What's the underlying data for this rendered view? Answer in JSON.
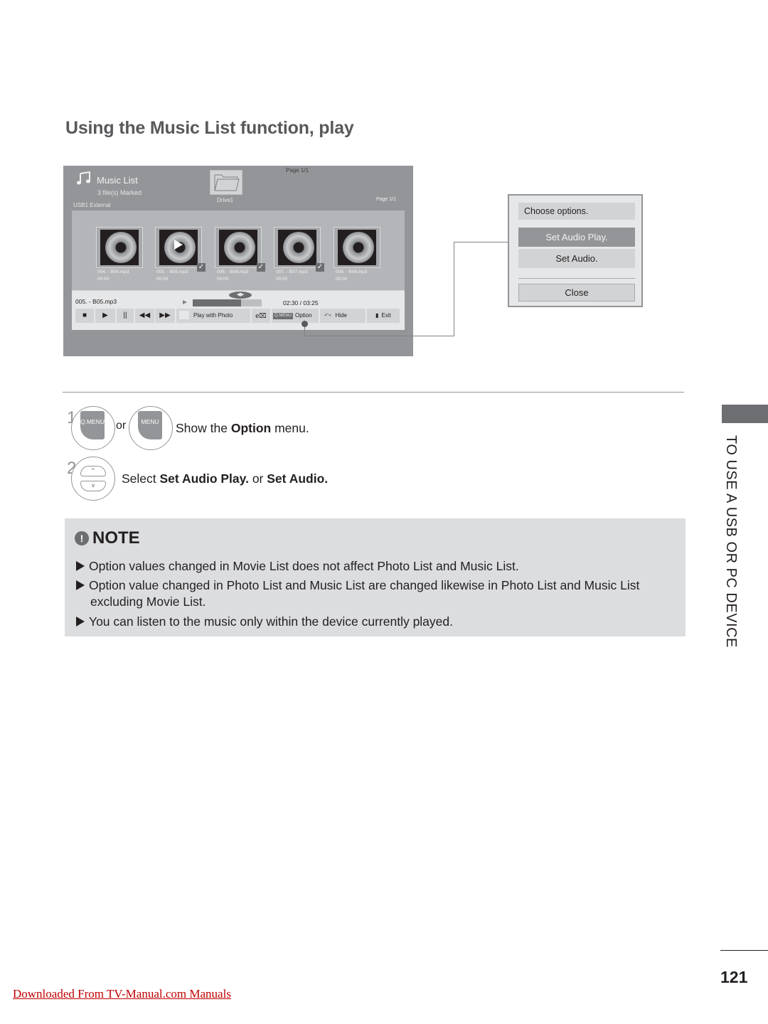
{
  "page": {
    "title": "Using the Music List function, play",
    "page_number": "121",
    "side_tab": "TO USE A USB OR PC DEVICE",
    "footer_link": "Downloaded From TV-Manual.com Manuals"
  },
  "tv_screen": {
    "header": {
      "title": "Music List",
      "marked": "3 file(s) Marked",
      "source": "USB1 External",
      "folder_label": "Drive1",
      "page_top": "Page 1/1",
      "page_right": "Page 1/1"
    },
    "files": [
      {
        "name": "004. - B04.mp3",
        "duration": "00:00",
        "checked": false,
        "playing": false
      },
      {
        "name": "005. - B05.mp3",
        "duration": "00:00",
        "checked": true,
        "playing": true
      },
      {
        "name": "006. - B06.mp3",
        "duration": "00:00",
        "checked": true,
        "playing": false
      },
      {
        "name": "007. - B07.mp3",
        "duration": "00:00",
        "checked": true,
        "playing": false
      },
      {
        "name": "008. - B08.mp3",
        "duration": "00:00",
        "checked": false,
        "playing": false
      }
    ],
    "player": {
      "now_playing": "005. - B05.mp3",
      "time": "02:30 / 03:25",
      "progress_fraction": 0.7,
      "speaker_glyph": "◀▶"
    },
    "controls": {
      "stop": "■",
      "play": "▶",
      "pause": "||",
      "rewind": "◀◀",
      "forward": "▶▶",
      "play_with_photo": "Play with Photo",
      "energy_icon": "e⌧",
      "qmenu_tag": "Q.MENU",
      "option": "Option",
      "hide_glyph": "↶•",
      "hide": "Hide",
      "exit_glyph": "▮",
      "exit": "Exit"
    }
  },
  "options_popup": {
    "title": "Choose options.",
    "items": [
      "Set Audio Play.",
      "Set Audio."
    ],
    "selected_index": 0,
    "close": "Close"
  },
  "steps": [
    {
      "number": "1",
      "keys": [
        "Q.MENU",
        "MENU"
      ],
      "or": "or",
      "text_pre": "Show the ",
      "text_bold": "Option",
      "text_post": " menu."
    },
    {
      "number": "2",
      "keys": [
        "^",
        "v"
      ],
      "text_pre": "Select ",
      "bold1": "Set Audio Play.",
      "mid": " or ",
      "bold2": "Set Audio."
    }
  ],
  "note": {
    "icon": "!",
    "title": "NOTE",
    "items": [
      "Option values changed in Movie List does not affect Photo List and Music List.",
      "Option value changed in Photo List and Music List are changed likewise in Photo List and Music List",
      "excluding Movie List.",
      "You can listen to the music only within the device currently played."
    ]
  },
  "colors": {
    "screen_bg": "#939598",
    "panel_bg": "#e6e7e8",
    "selected_option": "#939598",
    "title_gray": "#58595b",
    "link_red": "#c00000"
  }
}
